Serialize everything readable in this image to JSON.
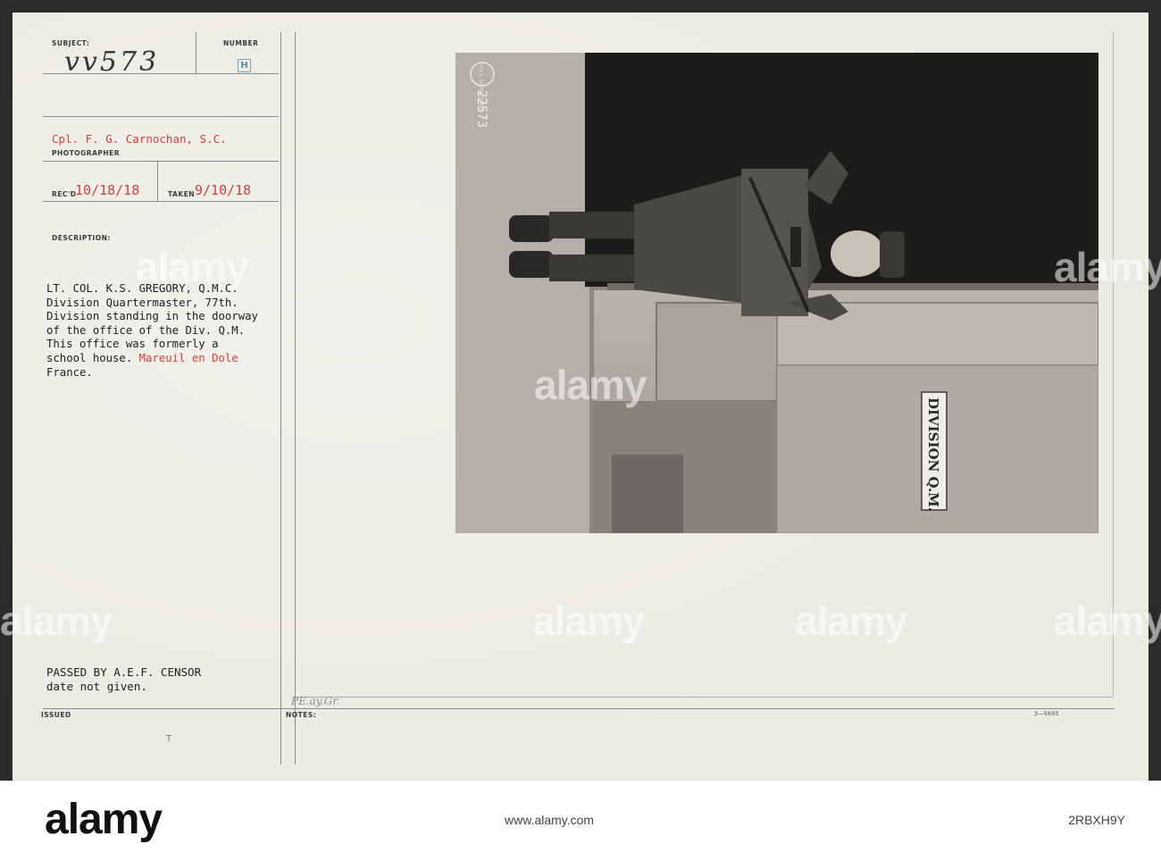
{
  "record": {
    "subject_label": "SUBJECT:",
    "subject_value": "vv573",
    "number_label": "NUMBER",
    "number_value": "H",
    "photographer": "Cpl. F. G. Carnochan, S.C.",
    "photographer_label": "PHOTOGRAPHER",
    "recd_label": "REC'D",
    "recd_date": "10/18/18",
    "taken_label": "TAKEN",
    "taken_date": "9/10/18",
    "description_label": "DESCRIPTION:",
    "description_lines": [
      "LT. COL. K.S. GREGORY, Q.M.C.",
      "Division Quartermaster, 77th.",
      "Division standing in the doorway",
      "of the office of the Div. Q.M.",
      "This office was formerly a",
      "school house. ",
      "France."
    ],
    "description_place": "Mareuil en Dole",
    "censor_line1": "PASSED BY A.E.F. CENSOR",
    "censor_line2": "date not given.",
    "issued_label": "ISSUED",
    "notes_label": "NOTES:",
    "notes_handwritten": "PE.ay.Gr.",
    "form_number": "3—5605",
    "issued_mark": "T"
  },
  "photo": {
    "stamp_number": "22573",
    "stamp_text": "U.S.A. SIGNAL CORPS",
    "sign_text": "DIVISION Q.M."
  },
  "watermark": {
    "text": "alamy"
  },
  "footer": {
    "logo": "alamy",
    "caption": "www.alamy.com",
    "stock_id": "2RBXH9Y"
  },
  "colors": {
    "card": "#ecebe3",
    "typed_red": "#d0413e",
    "ink": "#1e1e1e",
    "border": "#2b2b2b"
  }
}
